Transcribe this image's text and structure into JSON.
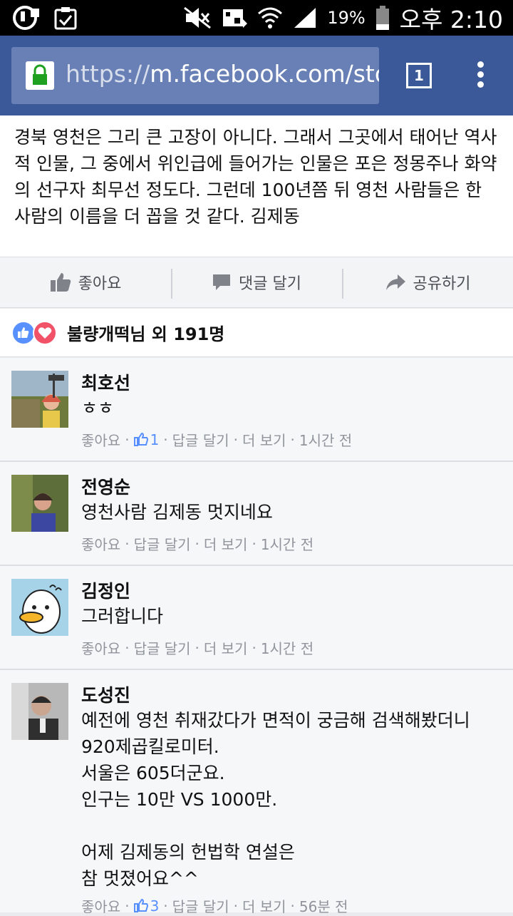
{
  "status_bar": {
    "battery": "19%",
    "time": "오후 2:10"
  },
  "browser": {
    "url_prefix": "https://",
    "url_host": "m.facebook.com/sto",
    "tab_count": "1"
  },
  "post": {
    "text": "경북 영천은 그리 큰 고장이 아니다. 그래서 그곳에서 태어난 역사적 인물, 그 중에서 위인급에 들어가는 인물은 포은 정몽주나 화약의 선구자 최무선 정도다. 그런데 100년쯤 뒤 영천 사람들은 한 사람의 이름을 더 꼽을 것 같다. 김제동"
  },
  "actions": {
    "like": "좋아요",
    "comment": "댓글 달기",
    "share": "공유하기"
  },
  "reactions": {
    "summary": "불량개떡님 외 191명"
  },
  "comments": [
    {
      "name": "최호선",
      "text": "ㅎㅎ",
      "like": "좋아요",
      "like_count": "1",
      "reply": "답글 달기",
      "more": "더 보기",
      "time": "1시간 전"
    },
    {
      "name": "전영순",
      "text": "영천사람 김제동 멋지네요",
      "like": "좋아요",
      "reply": "답글 달기",
      "more": "더 보기",
      "time": "1시간 전"
    },
    {
      "name": "김정인",
      "text": "그러합니다",
      "like": "좋아요",
      "reply": "답글 달기",
      "more": "더 보기",
      "time": "1시간 전"
    },
    {
      "name": "도성진",
      "text": "예전에 영천 취재갔다가 면적이 궁금해 검색해봤더니\n920제곱킬로미터.\n서울은 605더군요.\n인구는 10만 VS 1000만.\n\n어제 김제동의 헌법학 연설은\n참 멋졌어요^^",
      "like": "좋아요",
      "like_count": "3",
      "reply": "답글 달기",
      "more": "더 보기",
      "time": "56분 전"
    }
  ],
  "colors": {
    "facebook_blue": "#3b5998",
    "meta_gray": "#90949c",
    "like_blue": "#5890ff",
    "love_red": "#f25268"
  }
}
